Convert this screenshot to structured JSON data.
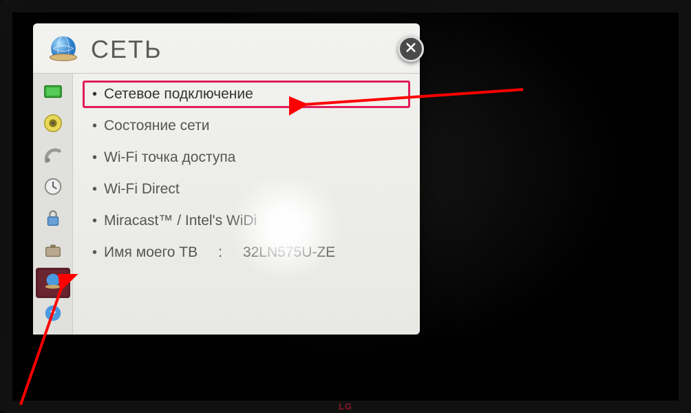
{
  "header": {
    "title": "СЕТЬ"
  },
  "sidebar": {
    "items": [
      {
        "name": "picture-icon"
      },
      {
        "name": "sound-icon"
      },
      {
        "name": "channel-icon"
      },
      {
        "name": "time-icon"
      },
      {
        "name": "lock-icon"
      },
      {
        "name": "option-icon"
      },
      {
        "name": "network-icon",
        "active": true
      },
      {
        "name": "support-icon"
      }
    ]
  },
  "menu": {
    "items": [
      {
        "label": "Сетевое подключение",
        "selected": true
      },
      {
        "label": "Состояние сети"
      },
      {
        "label": "Wi-Fi точка доступа"
      },
      {
        "label": "Wi-Fi Direct"
      },
      {
        "label": "Miracast™ / Intel's WiDi"
      },
      {
        "label": "Имя моего ТВ",
        "value": "32LN575U-ZE"
      }
    ]
  },
  "brand": "LG",
  "colors": {
    "highlight": "#e11b5a",
    "sidebar_active": "#6b2530",
    "arrow": "#ff0000"
  }
}
